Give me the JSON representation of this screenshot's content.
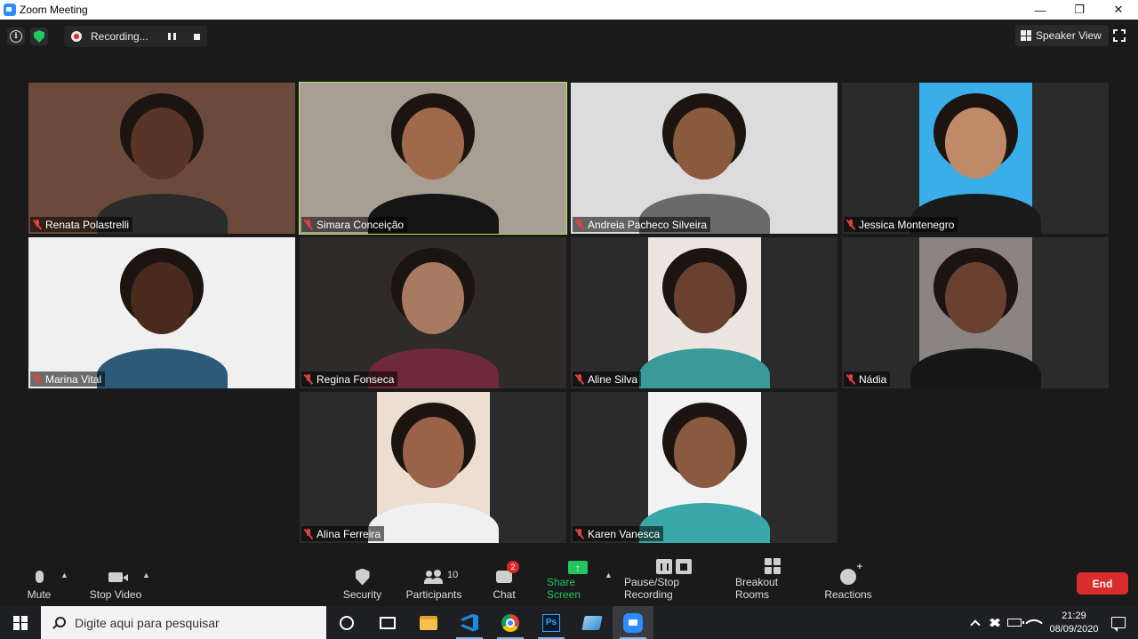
{
  "window": {
    "title": "Zoom Meeting",
    "minimize": "—",
    "restore": "❐",
    "close": "✕"
  },
  "top": {
    "recording_label": "Recording...",
    "speaker_view_label": "Speaker View"
  },
  "participants": [
    {
      "name": "Renata Polastrelli",
      "active": false,
      "bg": "#6b4a3c",
      "skin": "#5a3426",
      "shirt": "#2b2b2b"
    },
    {
      "name": "Simara Conceição",
      "active": true,
      "bg": "#a89e93",
      "skin": "#a06a4a",
      "shirt": "#151515"
    },
    {
      "name": "Andreia Pacheco Silveira",
      "active": false,
      "bg": "#dcdcdc",
      "skin": "#8a5a3e",
      "shirt": "#6a6a6a"
    },
    {
      "name": "Jessica Montenegro",
      "active": false,
      "bg": "#3aaee8",
      "skin": "#c08a68",
      "shirt": "#1a1a1a"
    },
    {
      "name": "Marina Vital",
      "active": false,
      "bg": "#f0f0f0",
      "skin": "#4a2a1c",
      "shirt": "#2e5a7a"
    },
    {
      "name": "Regina Fonseca",
      "active": false,
      "bg": "#2f2b29",
      "skin": "#a87a62",
      "shirt": "#6e2a3a"
    },
    {
      "name": "Aline Silva",
      "active": false,
      "bg": "#ece6e0",
      "skin": "#6a4030",
      "shirt": "#3a9a9a"
    },
    {
      "name": "Nádia",
      "active": false,
      "bg": "#8a8582",
      "skin": "#6a4030",
      "shirt": "#161616"
    },
    {
      "name": "Alina Ferreira",
      "active": false,
      "bg": "#ecdfd2",
      "skin": "#9a6248",
      "shirt": "#f0f0f0"
    },
    {
      "name": "Karen Vanesca",
      "active": false,
      "bg": "#f2f2f2",
      "skin": "#8a5a40",
      "shirt": "#3aa8a8"
    }
  ],
  "toolbar": {
    "mute": "Mute",
    "stop_video": "Stop Video",
    "security": "Security",
    "participants": "Participants",
    "participants_count": "10",
    "chat": "Chat",
    "chat_badge": "2",
    "share_screen": "Share Screen",
    "pause_stop_recording": "Pause/Stop Recording",
    "breakout_rooms": "Breakout Rooms",
    "reactions": "Reactions",
    "end": "End"
  },
  "taskbar": {
    "search_placeholder": "Digite aqui para pesquisar",
    "time": "21:29",
    "date": "08/09/2020",
    "ps_label": "Ps"
  },
  "colors": {
    "active_speaker": "#b7e35a",
    "end": "#d92c2c",
    "share": "#22c55e",
    "zoom_blue": "#2d8cff"
  }
}
